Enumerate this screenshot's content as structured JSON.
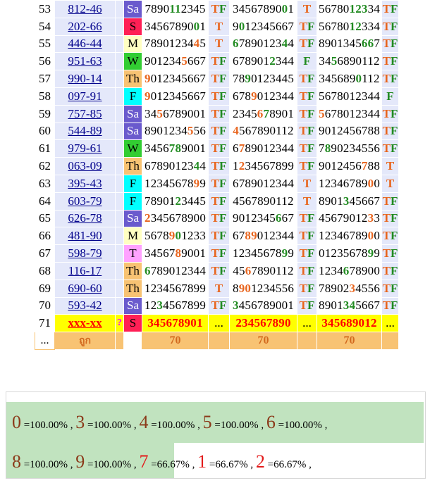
{
  "columns": [
    "num",
    "code",
    "day",
    "seq1",
    "tf1",
    "seq2",
    "tf2",
    "seq3",
    "tf3"
  ],
  "day_colors": {
    "Sa": "#6a5acd",
    "S": "#ff1f55",
    "M": "#ffffc2",
    "W": "#32cd32",
    "Th": "#f8c373",
    "F": "#00ffff",
    "T": "#ffa2ff"
  },
  "day_text_colors": {
    "Sa": "#ffffff",
    "S": "#000000",
    "M": "#000000",
    "W": "#000000",
    "Th": "#000000",
    "F": "#000000",
    "T": "#000000"
  },
  "rows": [
    {
      "num": "53",
      "code": "812-46",
      "day": "Sa",
      "s1": "7890112345",
      "h1": "0000110000",
      "t1": "TF",
      "s2": "3456789001",
      "h2": "0000000010",
      "t2": "T",
      "s3": "5678012334",
      "h3": "0000011100",
      "t3": "TF"
    },
    {
      "num": "54",
      "code": "202-66",
      "day": "S",
      "s1": "3456789001",
      "h1": "0000000010",
      "t1": "T",
      "s2": "9012345667",
      "h2": "0100000000",
      "t2": "TF",
      "s3": "5678012334",
      "h3": "0000011000",
      "t3": "TF"
    },
    {
      "num": "55",
      "code": "446-44",
      "day": "M",
      "s1": "7890123445",
      "h1": "0000000020",
      "t1": "T",
      "s2": "6789012344",
      "h2": "1000000010",
      "t2": "TF",
      "s3": "8901345667",
      "h3": "0000000110",
      "t3": "TF"
    },
    {
      "num": "56",
      "code": "951-63",
      "day": "W",
      "s1": "9012345667",
      "h1": "0000002000",
      "t1": "TF",
      "s2": "6789012344",
      "h2": "0000001000",
      "t2": "F",
      "s3": "3456890112",
      "h3": "0010000000",
      "t3": "TF"
    },
    {
      "num": "57",
      "code": "990-14",
      "day": "Th",
      "s1": "9012345667",
      "h1": "2000000000",
      "t1": "TF",
      "s2": "7890123445",
      "h2": "0010000000",
      "t2": "TF",
      "s3": "3456890112",
      "h3": "0000001000",
      "t3": "TF"
    },
    {
      "num": "58",
      "code": "097-91",
      "day": "F",
      "s1": "9012345667",
      "h1": "2000000000",
      "t1": "TF",
      "s2": "6789012344",
      "h2": "0002000000",
      "t2": "TF",
      "s3": "5678012344",
      "h3": "0000000000",
      "t3": "F"
    },
    {
      "num": "59",
      "code": "757-85",
      "day": "Sa",
      "s1": "3456789001",
      "h1": "0020000000",
      "t1": "TF",
      "s2": "2345678901",
      "h2": "0000210000",
      "t2": "TF",
      "s3": "5678012344",
      "h3": "2000000000",
      "t3": "TF"
    },
    {
      "num": "60",
      "code": "544-89",
      "day": "Sa",
      "s1": "8901234556",
      "h1": "0000000200",
      "t1": "TF",
      "s2": "4567890112",
      "h2": "2000000000",
      "t2": "TF",
      "s3": "9012456788",
      "h3": "0000000000",
      "t3": "TF"
    },
    {
      "num": "61",
      "code": "979-61",
      "day": "W",
      "s1": "3456789001",
      "h1": "0000110000",
      "t1": "TF",
      "s2": "6789012344",
      "h2": "0200000000",
      "t2": "TF",
      "s3": "7890234556",
      "h3": "0100000000",
      "t3": "TF"
    },
    {
      "num": "62",
      "code": "063-09",
      "day": "Th",
      "s1": "6789012344",
      "h1": "0000000010",
      "t1": "TF",
      "s2": "1234567899",
      "h2": "0200000000",
      "t2": "TF",
      "s3": "9012456788",
      "h3": "0000000200",
      "t3": "T"
    },
    {
      "num": "63",
      "code": "395-43",
      "day": "F",
      "s1": "1234567899",
      "h1": "0000000020",
      "t1": "TF",
      "s2": "6789012344",
      "h2": "0000000000",
      "t2": "T",
      "s3": "1234678900",
      "h3": "0000000020",
      "t3": "T"
    },
    {
      "num": "64",
      "code": "603-79",
      "day": "F",
      "s1": "7890123445",
      "h1": "0000010000",
      "t1": "TF",
      "s2": "4567890112",
      "h2": "0000000000",
      "t2": "T",
      "s3": "8901345667",
      "h3": "0000100000",
      "t3": "TF"
    },
    {
      "num": "65",
      "code": "626-78",
      "day": "Sa",
      "s1": "2345678900",
      "h1": "2000000000",
      "t1": "TF",
      "s2": "9012345667",
      "h2": "0000000100",
      "t2": "TF",
      "s3": "4567901233",
      "h3": "0000000020",
      "t3": "TF"
    },
    {
      "num": "66",
      "code": "481-90",
      "day": "M",
      "s1": "5678901233",
      "h1": "0000210000",
      "t1": "TF",
      "s2": "6789012344",
      "h2": "0022000000",
      "t2": "TF",
      "s3": "1234678900",
      "h3": "0000000020",
      "t3": "TF"
    },
    {
      "num": "67",
      "code": "598-79",
      "day": "T",
      "s1": "3456789001",
      "h1": "0000020000",
      "t1": "TF",
      "s2": "1234567899",
      "h2": "0000000010",
      "t2": "TF",
      "s3": "0123567899",
      "h3": "0000000010",
      "t3": "TF"
    },
    {
      "num": "68",
      "code": "116-17",
      "day": "Th",
      "s1": "6789012344",
      "h1": "1000000000",
      "t1": "TF",
      "s2": "4567890112",
      "h2": "0020000000",
      "t2": "TF",
      "s3": "1234678900",
      "h3": "0000100000",
      "t3": "TF"
    },
    {
      "num": "69",
      "code": "690-60",
      "day": "Th",
      "s1": "1234567899",
      "h1": "0000000000",
      "t1": "T",
      "s2": "8901234556",
      "h2": "0220000000",
      "t2": "TF",
      "s3": "7890234556",
      "h3": "0000020000",
      "t3": "TF"
    },
    {
      "num": "70",
      "code": "593-42",
      "day": "Sa",
      "s1": "1234567899",
      "h1": "0010000000",
      "t1": "TF",
      "s2": "3456789001",
      "h2": "1000000000",
      "t2": "TF",
      "s3": "8901345667",
      "h3": "0000110000",
      "t3": "TF"
    }
  ],
  "pending_row": {
    "num": "71",
    "code": "xxx-xx",
    "mark": "?",
    "day": "S",
    "s1": "345678901",
    "t1": "...",
    "s2": "234567890",
    "t2": "...",
    "s3": "345689012",
    "t3": "..."
  },
  "total_row": {
    "num": "...",
    "label": "ถูก",
    "c1": "70",
    "c2": "70",
    "c3": "70"
  },
  "stats_line1": [
    {
      "digit": "0",
      "pct": "=100.00%"
    },
    {
      "digit": "3",
      "pct": "=100.00%"
    },
    {
      "digit": "4",
      "pct": "=100.00%"
    },
    {
      "digit": "5",
      "pct": "=100.00%"
    },
    {
      "digit": "6",
      "pct": "=100.00%"
    }
  ],
  "stats_line2": [
    {
      "digit": "8",
      "pct": "=100.00%"
    },
    {
      "digit": "9",
      "pct": "=100.00%"
    },
    {
      "digit": "7",
      "pct": "=66.67%"
    },
    {
      "digit": "1",
      "pct": "=66.67%"
    },
    {
      "digit": "2",
      "pct": "=66.67%"
    }
  ],
  "separator": ","
}
